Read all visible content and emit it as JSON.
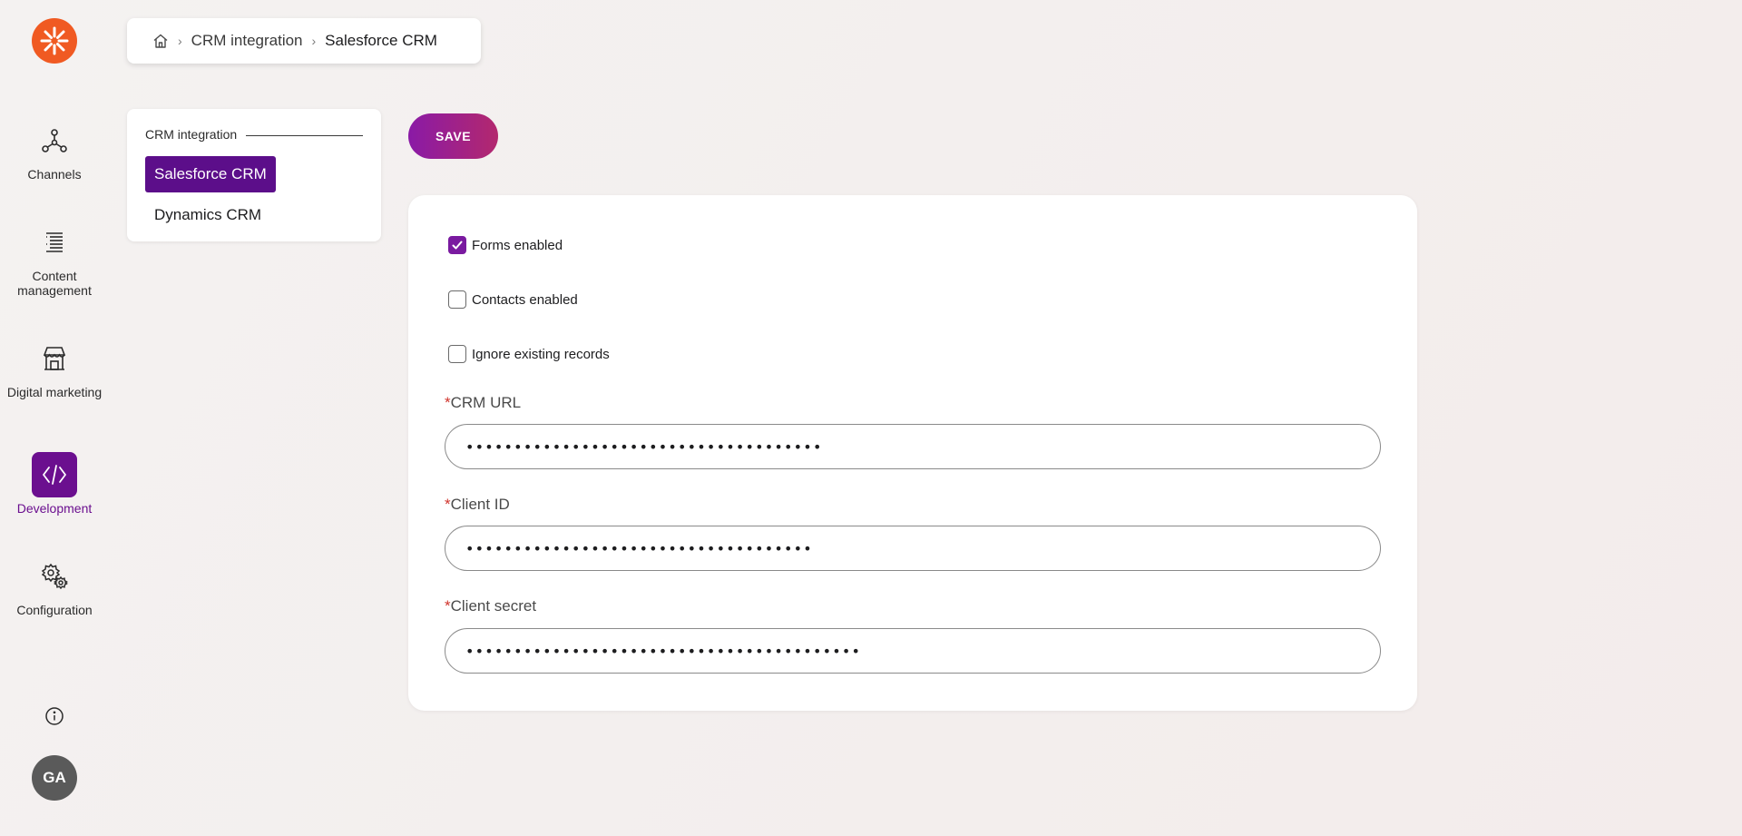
{
  "brand": {
    "color": "#f05a22",
    "accent": "#6b0f8f"
  },
  "nav": {
    "items": [
      {
        "label": "Channels",
        "icon": "channels-icon"
      },
      {
        "label": "Content management",
        "icon": "content-management-icon"
      },
      {
        "label": "Digital marketing",
        "icon": "digital-marketing-icon"
      },
      {
        "label": "Development",
        "icon": "development-icon",
        "active": true
      },
      {
        "label": "Configuration",
        "icon": "configuration-icon"
      }
    ],
    "avatar_initials": "GA"
  },
  "breadcrumb": {
    "items": [
      "CRM integration",
      "Salesforce CRM"
    ]
  },
  "subnav": {
    "group_label": "CRM integration",
    "items": [
      {
        "label": "Salesforce CRM",
        "selected": true
      },
      {
        "label": "Dynamics CRM",
        "selected": false
      }
    ]
  },
  "toolbar": {
    "save_label": "SAVE"
  },
  "form": {
    "checkboxes": [
      {
        "label": "Forms enabled",
        "checked": true
      },
      {
        "label": "Contacts enabled",
        "checked": false
      },
      {
        "label": "Ignore existing records",
        "checked": false
      }
    ],
    "required_marker": "*",
    "fields": [
      {
        "label": "CRM URL",
        "value": "•••••••••••••••••••••••••••••••••••••"
      },
      {
        "label": "Client ID",
        "value": "••••••••••••••••••••••••••••••••••••"
      },
      {
        "label": "Client secret",
        "value": "•••••••••••••••••••••••••••••••••••••••••"
      }
    ]
  }
}
